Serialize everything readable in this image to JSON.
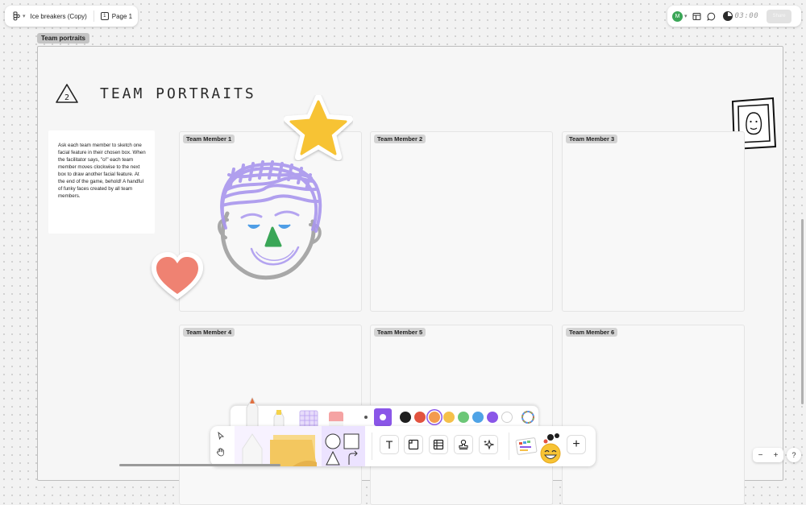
{
  "topbar": {
    "file_name": "Ice breakers (Copy)",
    "page_number": "1",
    "page_name": "Page 1"
  },
  "top_right": {
    "avatar_initial": "M",
    "avatar_color": "#3aa657",
    "timer": "03:00",
    "share_label": "Share"
  },
  "section": {
    "label": "Team portraits",
    "step_number": "2",
    "title": "TEAM PORTRAITS",
    "instructions": "Ask each team member to sketch one facial feature in their chosen box. When the facilitator says, \"o!\" each team member moves clockwise to the next box to draw another facial feature. At the end of the game, behold! A handful of funky faces created by all team members."
  },
  "cards": [
    {
      "label": "Team Member 1"
    },
    {
      "label": "Team Member 2"
    },
    {
      "label": "Team Member 3"
    },
    {
      "label": "Team Member 4"
    },
    {
      "label": "Team Member 5"
    },
    {
      "label": "Team Member 6"
    }
  ],
  "stickers": {
    "star_color": "#f7c334",
    "heart_color": "#ef8272",
    "face_hair_color": "#a996ee",
    "face_outline_color": "#a8a8a8"
  },
  "colors": {
    "swatches": [
      "#1e1e1e",
      "#e2533f",
      "#f39b4f",
      "#f5c04a",
      "#6cc777",
      "#4fa3e6",
      "#8a56e8",
      "#ffffff"
    ],
    "selected_index": 2,
    "accent": "#8a56e8"
  },
  "toolbar": {
    "tools": [
      "move-tool",
      "hand-tool",
      "marker",
      "highlighter",
      "washi-tape",
      "eraser",
      "sticky-note",
      "shapes",
      "connector",
      "text-tool",
      "section-tool",
      "table-tool",
      "stamp-tool",
      "ai-tool",
      "widgets",
      "add"
    ],
    "text_tool_glyph": "T",
    "add_glyph": "+"
  },
  "zoom": {
    "minus": "−",
    "plus": "+",
    "help": "?"
  }
}
